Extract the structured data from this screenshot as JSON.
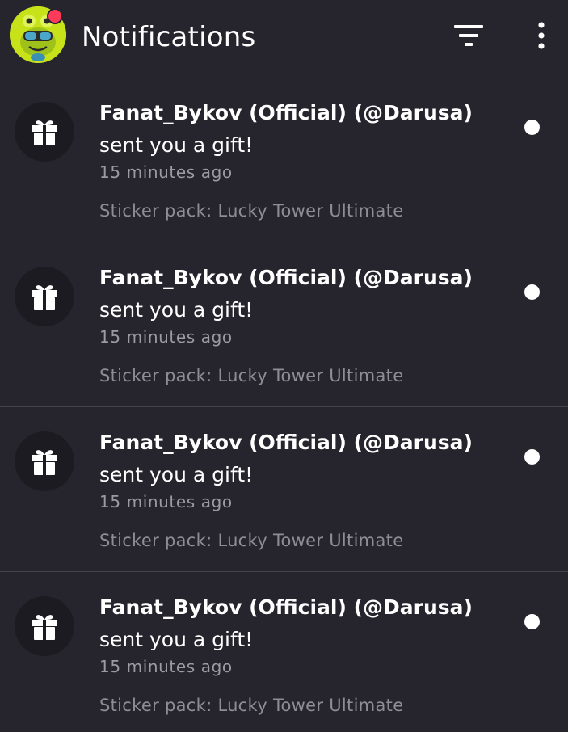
{
  "header": {
    "title": "Notifications",
    "avatar_icon": "frog-avatar-icon",
    "has_unread_badge": true,
    "filter_icon": "filter-icon",
    "more_icon": "more-vertical-icon"
  },
  "colors": {
    "background": "#26252d",
    "icon_circle": "#1c1b21",
    "divider": "#45444d",
    "badge": "#ff3b5c",
    "avatar": "#c8e21a",
    "secondary_text": "#9c9ba2"
  },
  "notifications": [
    {
      "icon": "gift-icon",
      "sender": "Fanat_Bykov (Official) (@Darusa)",
      "action": "sent you a gift!",
      "time": "15 minutes ago",
      "detail": "Sticker pack: Lucky Tower Ultimate",
      "unread": true
    },
    {
      "icon": "gift-icon",
      "sender": "Fanat_Bykov (Official) (@Darusa)",
      "action": "sent you a gift!",
      "time": "15 minutes ago",
      "detail": "Sticker pack: Lucky Tower Ultimate",
      "unread": true
    },
    {
      "icon": "gift-icon",
      "sender": "Fanat_Bykov (Official) (@Darusa)",
      "action": "sent you a gift!",
      "time": "15 minutes ago",
      "detail": "Sticker pack: Lucky Tower Ultimate",
      "unread": true
    },
    {
      "icon": "gift-icon",
      "sender": "Fanat_Bykov (Official) (@Darusa)",
      "action": "sent you a gift!",
      "time": "15 minutes ago",
      "detail": "Sticker pack: Lucky Tower Ultimate",
      "unread": true
    }
  ]
}
